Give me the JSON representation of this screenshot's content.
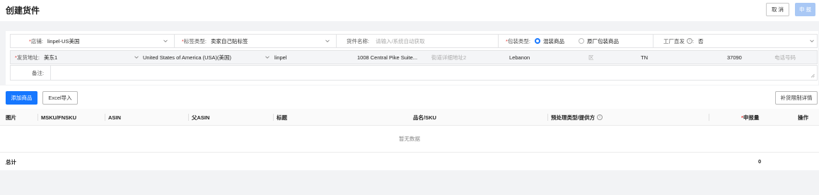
{
  "header": {
    "title": "创建货件",
    "cancel_label": "取 消",
    "submit_label": "申 报"
  },
  "form": {
    "store": {
      "required": "*",
      "label": "店铺:",
      "value": "linpel-US美国"
    },
    "label_type": {
      "required": "*",
      "label": "标签类型:",
      "value": "卖家自己贴标签"
    },
    "shipment_name": {
      "label": "货件名称:",
      "placeholder": "请输入/系统自动获取"
    },
    "package_type": {
      "required": "*",
      "label": "包装类型:",
      "options": [
        {
          "label": "混装商品",
          "selected": true
        },
        {
          "label": "原厂包装商品",
          "selected": false
        }
      ]
    },
    "factory_direct": {
      "label": "工厂直发",
      "info": "i",
      "suffix": ":",
      "value": "否"
    },
    "ship_from": {
      "required": "*",
      "label": "发货地址:",
      "value": "美东1",
      "country": "United States of America (USA)(美国)",
      "name": "linpel",
      "address1": "1008  Central Pike Suite...",
      "address2_placeholder": "街道详细地址2",
      "city": "Lebanon",
      "district_placeholder": "区",
      "state": "TN",
      "zip": "37090",
      "phone_placeholder": "电话号码"
    },
    "remark": {
      "label": "备注:"
    }
  },
  "toolbar": {
    "add_label": "添加商品",
    "excel_label": "Excel导入",
    "limit_label": "补货限制详情"
  },
  "table": {
    "columns": [
      "图片",
      "MSKU/FNSKU",
      "ASIN",
      "父ASIN",
      "标题",
      "品名/SKU",
      "预处理类型/提供方",
      "*申报量",
      "操作"
    ],
    "empty_text": "暂无数据",
    "total_label": "总计",
    "total_value": "0"
  },
  "colors": {
    "primary": "#1677ff",
    "required": "#e53935",
    "submit_disabled": "#a9c8f5"
  }
}
